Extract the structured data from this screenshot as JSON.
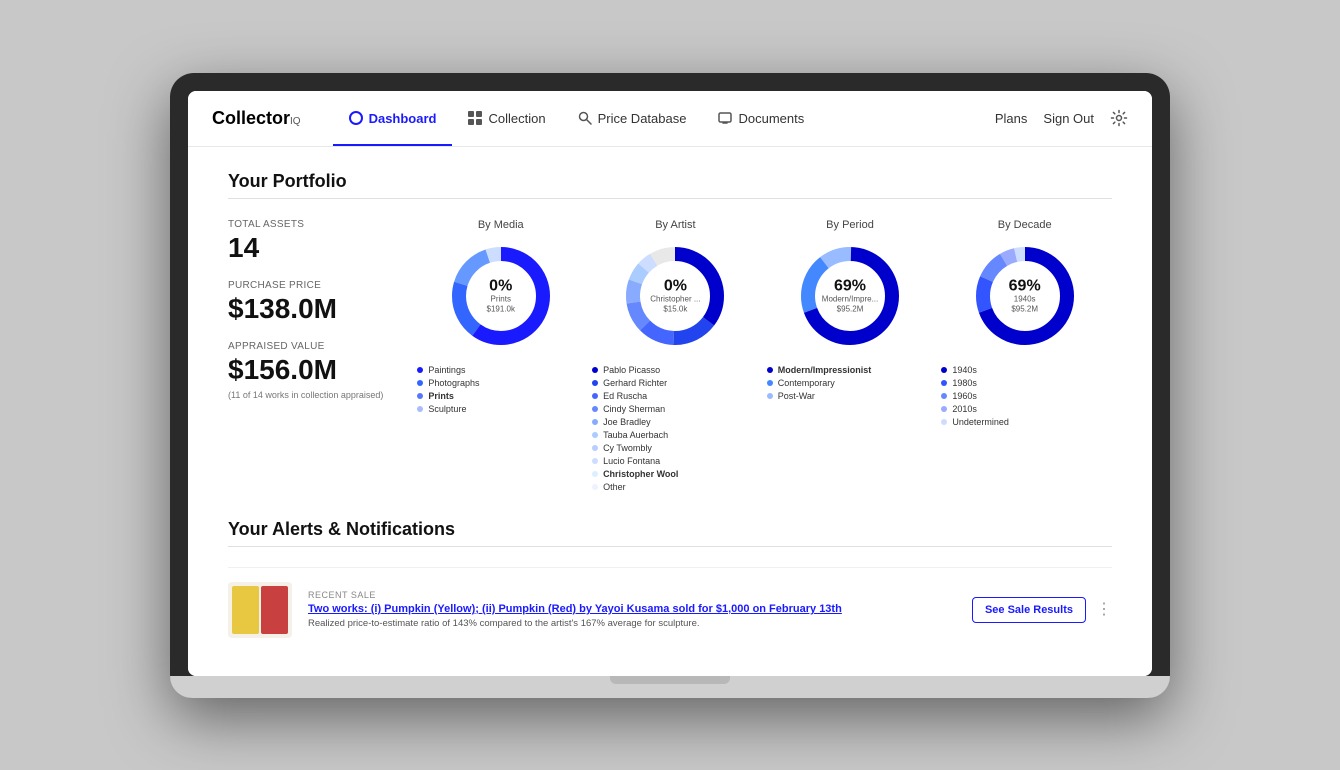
{
  "app": {
    "title": "Collector",
    "title_super": "IQ"
  },
  "nav": {
    "links": [
      {
        "id": "dashboard",
        "label": "Dashboard",
        "active": true,
        "icon": "dashboard-icon"
      },
      {
        "id": "collection",
        "label": "Collection",
        "active": false,
        "icon": "collection-icon"
      },
      {
        "id": "price-database",
        "label": "Price Database",
        "active": false,
        "icon": "search-icon"
      },
      {
        "id": "documents",
        "label": "Documents",
        "active": false,
        "icon": "monitor-icon"
      }
    ],
    "right": [
      {
        "id": "plans",
        "label": "Plans"
      },
      {
        "id": "sign-out",
        "label": "Sign Out"
      }
    ],
    "settings_label": "Settings"
  },
  "portfolio": {
    "section_title": "Your Portfolio",
    "stats": {
      "total_assets_label": "Total Assets",
      "total_assets_value": "14",
      "purchase_price_label": "Purchase Price",
      "purchase_price_value": "$138.0M",
      "appraised_value_label": "Appraised Value",
      "appraised_value_value": "$156.0M",
      "appraised_note": "(11 of 14 works in collection appraised)"
    },
    "charts": [
      {
        "id": "by-media",
        "title": "By Media",
        "pct": "0%",
        "sub_label": "Prints",
        "sub_value": "$191.0k",
        "segments": [
          {
            "color": "#1a1aff",
            "value": 60
          },
          {
            "color": "#3366ff",
            "value": 20
          },
          {
            "color": "#6699ff",
            "value": 15
          },
          {
            "color": "#ccddff",
            "value": 5
          }
        ],
        "legend": [
          {
            "label": "Paintings",
            "color": "#1a1aff",
            "bold": false
          },
          {
            "label": "Photographs",
            "color": "#3366ff",
            "bold": false
          },
          {
            "label": "Prints",
            "color": "#5577ff",
            "bold": true
          },
          {
            "label": "Sculpture",
            "color": "#aabbff",
            "bold": false
          }
        ]
      },
      {
        "id": "by-artist",
        "title": "By Artist",
        "pct": "0%",
        "sub_label": "Christopher ...",
        "sub_value": "$15.0k",
        "segments": [
          {
            "color": "#0000cc",
            "value": 35
          },
          {
            "color": "#2244ee",
            "value": 15
          },
          {
            "color": "#4466ff",
            "value": 12
          },
          {
            "color": "#6688ff",
            "value": 10
          },
          {
            "color": "#88aaff",
            "value": 8
          },
          {
            "color": "#aaccff",
            "value": 6
          },
          {
            "color": "#ccddff",
            "value": 5
          },
          {
            "color": "#ddeeff",
            "value": 5
          },
          {
            "color": "#eef2ff",
            "value": 4
          }
        ],
        "legend": [
          {
            "label": "Pablo Picasso",
            "color": "#0000cc",
            "bold": false
          },
          {
            "label": "Gerhard Richter",
            "color": "#2244ee",
            "bold": false
          },
          {
            "label": "Ed Ruscha",
            "color": "#4466ff",
            "bold": false
          },
          {
            "label": "Cindy Sherman",
            "color": "#6688ff",
            "bold": false
          },
          {
            "label": "Joe Bradley",
            "color": "#88aaff",
            "bold": false
          },
          {
            "label": "Tauba Auerbach",
            "color": "#aaccff",
            "bold": false
          },
          {
            "label": "Cy Twombly",
            "color": "#bbccff",
            "bold": false
          },
          {
            "label": "Lucio Fontana",
            "color": "#ccddff",
            "bold": false
          },
          {
            "label": "Christopher Wool",
            "color": "#ddeeff",
            "bold": true
          },
          {
            "label": "Other",
            "color": "#eef2ff",
            "bold": false
          }
        ]
      },
      {
        "id": "by-period",
        "title": "By Period",
        "pct": "69%",
        "sub_label": "Modern/Impre...",
        "sub_value": "$95.2M",
        "segments": [
          {
            "color": "#0000cc",
            "value": 69
          },
          {
            "color": "#4488ff",
            "value": 20
          },
          {
            "color": "#99bbff",
            "value": 11
          }
        ],
        "legend": [
          {
            "label": "Modern/Impressionist",
            "color": "#0000cc",
            "bold": true
          },
          {
            "label": "Contemporary",
            "color": "#4488ff",
            "bold": false
          },
          {
            "label": "Post-War",
            "color": "#99bbff",
            "bold": false
          }
        ]
      },
      {
        "id": "by-decade",
        "title": "By Decade",
        "pct": "69%",
        "sub_label": "1940s",
        "sub_value": "$95.2M",
        "segments": [
          {
            "color": "#0000cc",
            "value": 69
          },
          {
            "color": "#3355ff",
            "value": 12
          },
          {
            "color": "#6688ff",
            "value": 10
          },
          {
            "color": "#99aaff",
            "value": 5
          },
          {
            "color": "#ccddff",
            "value": 4
          }
        ],
        "legend": [
          {
            "label": "1940s",
            "color": "#0000cc",
            "bold": false
          },
          {
            "label": "1980s",
            "color": "#3355ff",
            "bold": false
          },
          {
            "label": "1960s",
            "color": "#6688ff",
            "bold": false
          },
          {
            "label": "2010s",
            "color": "#99aaff",
            "bold": false
          },
          {
            "label": "Undetermined",
            "color": "#ccddff",
            "bold": false
          }
        ]
      }
    ]
  },
  "alerts": {
    "section_title": "Your Alerts & Notifications",
    "items": [
      {
        "tag": "Recent sale",
        "title": "Two works: (i) Pumpkin (Yellow); (ii) Pumpkin (Red) by Yayoi Kusama sold for $1,000 on February 13th",
        "description": "Realized price-to-estimate ratio of 143% compared to the artist's 167% average for sculpture.",
        "button_label": "See Sale Results"
      }
    ]
  }
}
